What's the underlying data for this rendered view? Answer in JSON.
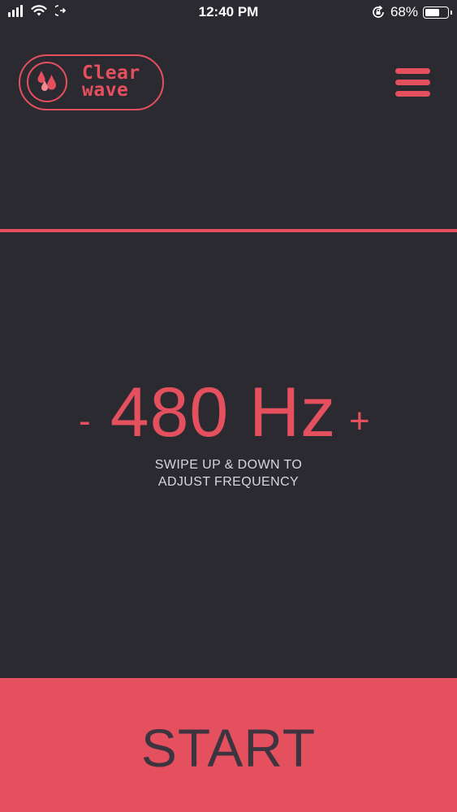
{
  "status_bar": {
    "time": "12:40 PM",
    "battery_percent": "68%",
    "battery_level": 0.68
  },
  "logo": {
    "line1": "Clear",
    "line2": "wave"
  },
  "frequency": {
    "minus_label": "-",
    "value": "480 Hz",
    "plus_label": "+"
  },
  "hint": {
    "line1": "SWIPE UP & DOWN TO",
    "line2": "ADJUST FREQUENCY"
  },
  "start_button": {
    "label": "START"
  },
  "colors": {
    "background": "#2c2a31",
    "accent": "#e5505f",
    "start_text": "#3d3440"
  },
  "icons": {
    "menu": "hamburger-menu-icon",
    "logo": "water-drops-icon"
  }
}
